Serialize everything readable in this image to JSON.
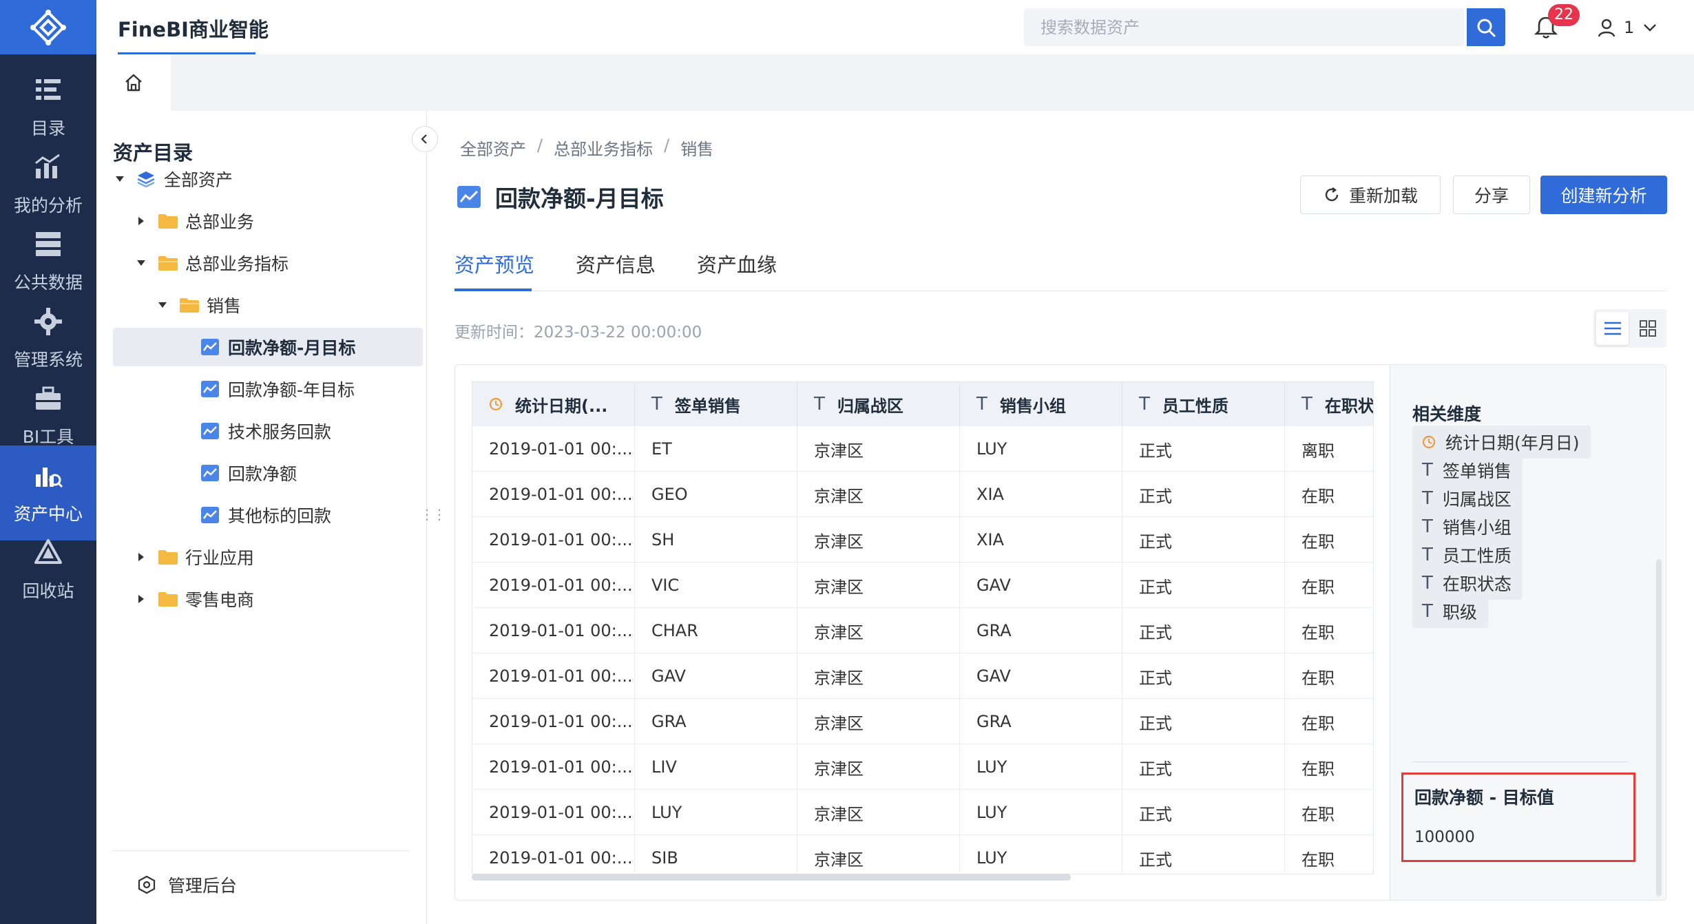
{
  "app": {
    "title": "FineBI商业智能"
  },
  "search": {
    "placeholder": "搜索数据资产"
  },
  "notifications": {
    "count": "22"
  },
  "user": {
    "name": "1"
  },
  "nav": {
    "items": [
      {
        "label": "目录",
        "icon": "catalog-icon"
      },
      {
        "label": "我的分析",
        "icon": "analysis-icon"
      },
      {
        "label": "公共数据",
        "icon": "public-data-icon"
      },
      {
        "label": "管理系统",
        "icon": "gear-icon"
      },
      {
        "label": "BI工具",
        "icon": "toolbox-icon"
      },
      {
        "label": "资产中心",
        "icon": "asset-center-icon",
        "active": true
      },
      {
        "label": "回收站",
        "icon": "recycle-icon"
      }
    ]
  },
  "directory": {
    "title": "资产目录",
    "tree": [
      {
        "label": "全部资产",
        "icon": "layers-icon",
        "expanded": true
      },
      {
        "label": "总部业务",
        "icon": "folder-icon",
        "expanded": false
      },
      {
        "label": "总部业务指标",
        "icon": "folder-open-icon",
        "expanded": true
      },
      {
        "label": "销售",
        "icon": "folder-open-icon",
        "expanded": true
      },
      {
        "label": "回款净额-月目标",
        "icon": "chart-asset-icon",
        "selected": true
      },
      {
        "label": "回款净额-年目标",
        "icon": "chart-asset-icon"
      },
      {
        "label": "技术服务回款",
        "icon": "chart-asset-icon"
      },
      {
        "label": "回款净额",
        "icon": "chart-asset-icon"
      },
      {
        "label": "其他标的回款",
        "icon": "chart-asset-icon"
      },
      {
        "label": "行业应用",
        "icon": "folder-icon",
        "expanded": false
      },
      {
        "label": "零售电商",
        "icon": "folder-icon",
        "expanded": false
      }
    ],
    "admin_label": "管理后台"
  },
  "breadcrumb": [
    "全部资产",
    "总部业务指标",
    "销售"
  ],
  "asset": {
    "title": "回款净额-月目标"
  },
  "actions": {
    "reload": "重新加载",
    "share": "分享",
    "create": "创建新分析"
  },
  "tabs": [
    "资产预览",
    "资产信息",
    "资产血缘"
  ],
  "update_time": "更新时间：2023-03-22 00:00:00",
  "table": {
    "columns": [
      {
        "label": "统计日期(...",
        "type": "date"
      },
      {
        "label": "签单销售",
        "type": "text"
      },
      {
        "label": "归属战区",
        "type": "text"
      },
      {
        "label": "销售小组",
        "type": "text"
      },
      {
        "label": "员工性质",
        "type": "text"
      },
      {
        "label": "在职状",
        "type": "text"
      }
    ],
    "rows": [
      [
        "2019-01-01 00:...",
        "ET",
        "京津区",
        "LUY",
        "正式",
        "离职"
      ],
      [
        "2019-01-01 00:...",
        "GEO",
        "京津区",
        "XIA",
        "正式",
        "在职"
      ],
      [
        "2019-01-01 00:...",
        "SH",
        "京津区",
        "XIA",
        "正式",
        "在职"
      ],
      [
        "2019-01-01 00:...",
        "VIC",
        "京津区",
        "GAV",
        "正式",
        "在职"
      ],
      [
        "2019-01-01 00:...",
        "CHAR",
        "京津区",
        "GRA",
        "正式",
        "在职"
      ],
      [
        "2019-01-01 00:...",
        "GAV",
        "京津区",
        "GAV",
        "正式",
        "在职"
      ],
      [
        "2019-01-01 00:...",
        "GRA",
        "京津区",
        "GRA",
        "正式",
        "在职"
      ],
      [
        "2019-01-01 00:...",
        "LIV",
        "京津区",
        "LUY",
        "正式",
        "在职"
      ],
      [
        "2019-01-01 00:...",
        "LUY",
        "京津区",
        "LUY",
        "正式",
        "在职"
      ],
      [
        "2019-01-01 00:...",
        "SIB",
        "京津区",
        "LUY",
        "正式",
        "在职"
      ]
    ]
  },
  "side": {
    "dimensions_title": "相关维度",
    "dimensions": [
      {
        "label": "统计日期(年月日)",
        "type": "date"
      },
      {
        "label": "签单销售",
        "type": "text"
      },
      {
        "label": "归属战区",
        "type": "text"
      },
      {
        "label": "销售小组",
        "type": "text"
      },
      {
        "label": "员工性质",
        "type": "text"
      },
      {
        "label": "在职状态",
        "type": "text"
      },
      {
        "label": "职级",
        "type": "text"
      }
    ],
    "metric_label": "回款净额 - 目标值",
    "metric_value": "100000"
  },
  "colors": {
    "brand": "#2f6bd9",
    "nav_bg": "#1d2c4a",
    "badge": "#e5344c",
    "highlight_border": "#e23b3b",
    "folder": "#f5b942",
    "date_icon": "#f09a3e"
  }
}
